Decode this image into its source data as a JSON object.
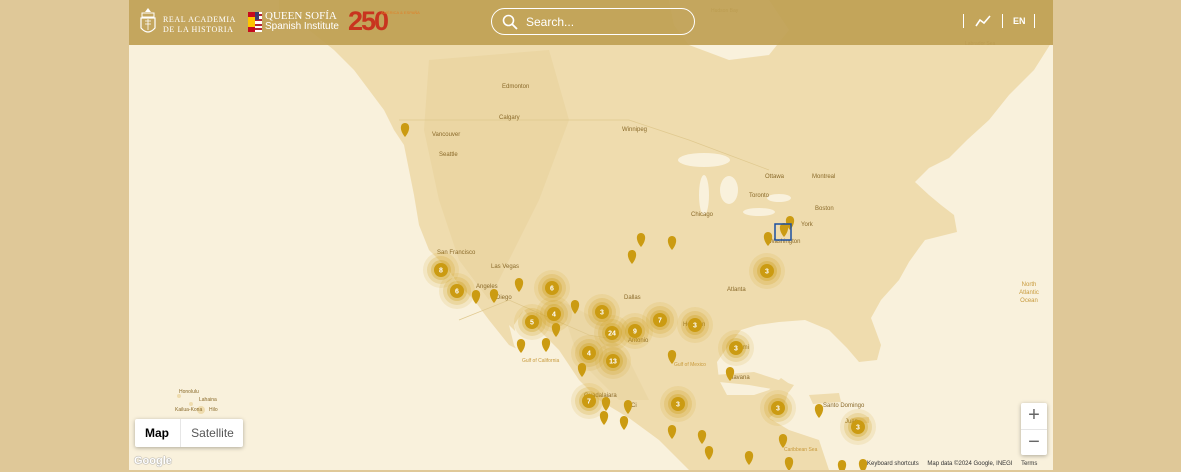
{
  "header": {
    "rah_logo_text": "REAL ACADEMIA\nDE LA HISTORIA",
    "queen_sofia_title": "QUEEN SOFÍA",
    "queen_sofia_subtitle": "Spanish Institute",
    "anniversary_number": "250",
    "anniversary_caption": "AMÉRICA & ESPAÑA",
    "search_placeholder": "Search...",
    "language": "EN"
  },
  "map": {
    "map_type_options": [
      "Map",
      "Satellite"
    ],
    "selected_map_type": "Map",
    "zoom_in_label": "+",
    "zoom_out_label": "−",
    "google_logo": "Google",
    "attribution": [
      "Keyboard shortcuts",
      "Map data ©2024 Google, INEGI",
      "Terms"
    ],
    "colors": {
      "marker": "#cb9b12",
      "land": "#efdcae",
      "water": "#f9f1dc",
      "header": "#c0a054"
    },
    "place_labels": [
      "Edmonton",
      "Calgary",
      "Winnipeg",
      "Vancouver",
      "Seattle",
      "Ottawa",
      "Montreal",
      "Toronto",
      "Boston",
      "Chicago",
      "York",
      "Washington",
      "San Francisco",
      "Las Vegas",
      "Angeles",
      "Diego",
      "Dallas",
      "Atlanta",
      "Antonio",
      "Houston",
      "Miami",
      "Gulf of California",
      "Gulf of Mexico",
      "Havana",
      "Guadalajara",
      "Ci",
      "Santo Domingo",
      "Juan",
      "Caribbean Sea",
      "North Atlantic Ocean",
      "Honolulu",
      "Lahaina",
      "Kailua-Kona",
      "Hilo",
      "Hudson Bay",
      "Labrador Sea"
    ],
    "clusters": [
      {
        "label": "8"
      },
      {
        "label": "6"
      },
      {
        "label": "6"
      },
      {
        "label": "4"
      },
      {
        "label": "5"
      },
      {
        "label": "3"
      },
      {
        "label": "24"
      },
      {
        "label": "9"
      },
      {
        "label": "7"
      },
      {
        "label": "3"
      },
      {
        "label": "4"
      },
      {
        "label": "13"
      },
      {
        "label": "3"
      },
      {
        "label": "3"
      },
      {
        "label": "7"
      },
      {
        "label": "3"
      },
      {
        "label": "3"
      },
      {
        "label": "3"
      },
      {
        "label": "6"
      }
    ],
    "pin_count": 30
  }
}
